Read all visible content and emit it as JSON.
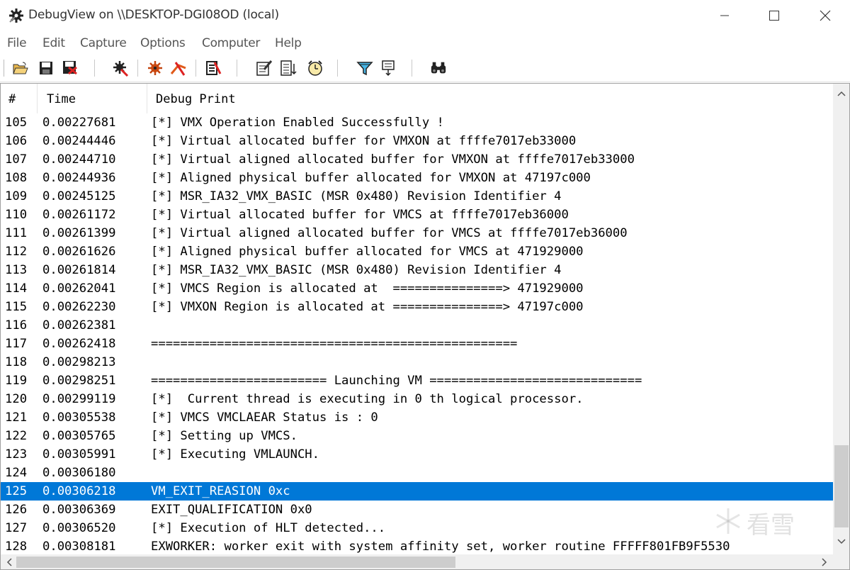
{
  "window": {
    "title": "DebugView on \\\\DESKTOP-DGI08OD (local)",
    "app_icon": "debugview-gear-icon",
    "controls": [
      "minimize-icon",
      "maximize-icon",
      "close-icon"
    ]
  },
  "menu": [
    "File",
    "Edit",
    "Capture",
    "Options",
    "Computer",
    "Help"
  ],
  "toolbar": {
    "buttons": [
      "open-icon",
      "save-icon",
      "save-as-icon",
      "capture-icon",
      "capture-kernel-icon",
      "capture-passthrough-icon",
      "autoscroll-icon",
      "clear-display-icon",
      "time-format-icon",
      "clock-time-icon",
      "filter-highlight-icon",
      "history-depth-icon",
      "find-icon"
    ]
  },
  "list": {
    "columns": [
      "#",
      "Time",
      "Debug Print"
    ],
    "selected_row": "125",
    "rows": [
      {
        "num": "105",
        "time": "0.00227681",
        "msg": "[*] VMX Operation Enabled Successfully !"
      },
      {
        "num": "106",
        "time": "0.00244446",
        "msg": "[*] Virtual allocated buffer for VMXON at ffffe7017eb33000"
      },
      {
        "num": "107",
        "time": "0.00244710",
        "msg": "[*] Virtual aligned allocated buffer for VMXON at ffffe7017eb33000"
      },
      {
        "num": "108",
        "time": "0.00244936",
        "msg": "[*] Aligned physical buffer allocated for VMXON at 47197c000"
      },
      {
        "num": "109",
        "time": "0.00245125",
        "msg": "[*] MSR_IA32_VMX_BASIC (MSR 0x480) Revision Identifier 4"
      },
      {
        "num": "110",
        "time": "0.00261172",
        "msg": "[*] Virtual allocated buffer for VMCS at ffffe7017eb36000"
      },
      {
        "num": "111",
        "time": "0.00261399",
        "msg": "[*] Virtual aligned allocated buffer for VMCS at ffffe7017eb36000"
      },
      {
        "num": "112",
        "time": "0.00261626",
        "msg": "[*] Aligned physical buffer allocated for VMCS at 471929000"
      },
      {
        "num": "113",
        "time": "0.00261814",
        "msg": "[*] MSR_IA32_VMX_BASIC (MSR 0x480) Revision Identifier 4"
      },
      {
        "num": "114",
        "time": "0.00262041",
        "msg": "[*] VMCS Region is allocated at  ===============> 471929000"
      },
      {
        "num": "115",
        "time": "0.00262230",
        "msg": "[*] VMXON Region is allocated at ===============> 47197c000"
      },
      {
        "num": "116",
        "time": "0.00262381",
        "msg": ""
      },
      {
        "num": "117",
        "time": "0.00262418",
        "msg": "=================================================="
      },
      {
        "num": "118",
        "time": "0.00298213",
        "msg": ""
      },
      {
        "num": "119",
        "time": "0.00298251",
        "msg": "======================== Launching VM ============================="
      },
      {
        "num": "120",
        "time": "0.00299119",
        "msg": "[*]  Current thread is executing in 0 th logical processor."
      },
      {
        "num": "121",
        "time": "0.00305538",
        "msg": "[*] VMCS VMCLAEAR Status is : 0"
      },
      {
        "num": "122",
        "time": "0.00305765",
        "msg": "[*] Setting up VMCS."
      },
      {
        "num": "123",
        "time": "0.00305991",
        "msg": "[*] Executing VMLAUNCH."
      },
      {
        "num": "124",
        "time": "0.00306180",
        "msg": ""
      },
      {
        "num": "125",
        "time": "0.00306218",
        "msg": "VM_EXIT_REASION 0xc"
      },
      {
        "num": "126",
        "time": "0.00306369",
        "msg": "EXIT_QUALIFICATION 0x0"
      },
      {
        "num": "127",
        "time": "0.00306520",
        "msg": "[*] Execution of HLT detected..."
      },
      {
        "num": "128",
        "time": "0.00308181",
        "msg": "EXWORKER: worker exit with system affinity set, worker routine FFFFF801FB9F5530"
      }
    ]
  },
  "scrollbars": {
    "vertical_up": "up-arrow-icon",
    "vertical_down": "down-arrow-icon",
    "horizontal_left": "left-arrow-icon",
    "horizontal_right": "right-arrow-icon"
  },
  "watermark": {
    "mark": "snowflake-logo-icon",
    "text": "看雪"
  },
  "colors": {
    "selection": "#0078d7",
    "background": "#ffffff",
    "scrollbar": "#f0f0f0"
  }
}
